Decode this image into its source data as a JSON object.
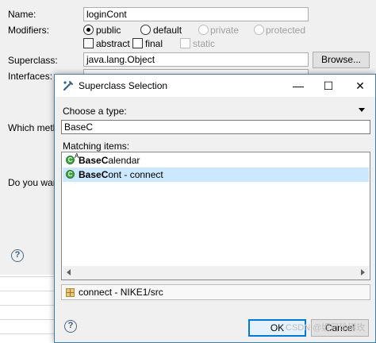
{
  "wizard": {
    "name_label": "Name:",
    "name_value": "loginCont",
    "modifiers_label": "Modifiers:",
    "modifiers": {
      "public": "public",
      "default": "default",
      "private": "private",
      "protected": "protected",
      "abstract": "abstract",
      "final": "final",
      "static": "static",
      "selected": "public"
    },
    "superclass_label": "Superclass:",
    "superclass_value": "java.lang.Object",
    "browse_label": "Browse...",
    "interfaces_label": "Interfaces:",
    "which_methods_label": "Which meth",
    "do_you_want_label": "Do you wan",
    "help_symbol": "?"
  },
  "dialog": {
    "title": "Superclass Selection",
    "minimize_symbol": "—",
    "maximize_symbol": "☐",
    "close_symbol": "✕",
    "choose_label": "Choose a type:",
    "search_value": "BaseC",
    "matching_label": "Matching items:",
    "items": [
      {
        "match": "BaseC",
        "rest": "alendar",
        "abstract": true,
        "selected": false
      },
      {
        "match": "BaseC",
        "rest": "ont - connect",
        "abstract": false,
        "selected": true
      }
    ],
    "abstract_mark": "A",
    "class_icon_letter": "C",
    "status_text": "connect - NIKE1/src",
    "help_symbol": "?",
    "ok_label": "OK",
    "cancel_label": "Cancel"
  },
  "watermark": "CSDN @妮可珍稀玫",
  "colors": {
    "selection": "#cce8ff",
    "default_button_border": "#0078d7",
    "class_icon": "#3aa43a"
  }
}
